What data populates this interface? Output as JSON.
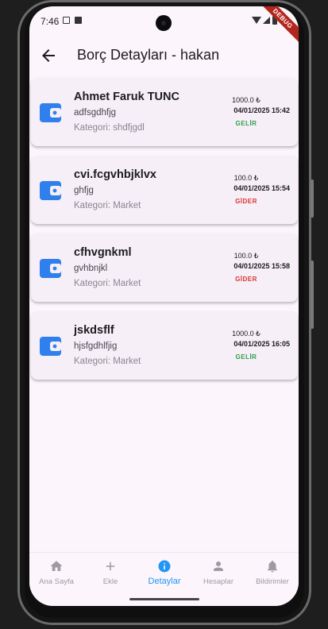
{
  "status_bar": {
    "time": "7:46",
    "debug_label": "DEBUG"
  },
  "app_bar": {
    "title": "Borç Detayları - hakan"
  },
  "colors": {
    "income": "#2e9e48",
    "expense": "#d9362c",
    "accent": "#2196f3",
    "wallet": "#2f80ed"
  },
  "debts": [
    {
      "name": "Ahmet Faruk TUNC",
      "description": "adfsgdhfjg",
      "category": "Kategori: shdfjgdl",
      "amount": "1000.0 ₺",
      "date": "04/01/2025 15:42",
      "type": "GELİR",
      "kind": "income"
    },
    {
      "name": "cvi.fcgvhbjklvx",
      "description": "ghfjg",
      "category": "Kategori: Market",
      "amount": "100.0 ₺",
      "date": "04/01/2025 15:54",
      "type": "GİDER",
      "kind": "expense"
    },
    {
      "name": "cfhvgnkml",
      "description": "gvhbnjkl",
      "category": "Kategori: Market",
      "amount": "100.0 ₺",
      "date": "04/01/2025 15:58",
      "type": "GİDER",
      "kind": "expense"
    },
    {
      "name": "jskdsflf",
      "description": "hjsfgdhlfjig",
      "category": "Kategori: Market",
      "amount": "1000.0 ₺",
      "date": "04/01/2025 16:05",
      "type": "GELİR",
      "kind": "income"
    }
  ],
  "bottom_nav": {
    "items": [
      {
        "label": "Ana Sayfa",
        "icon": "home-icon",
        "active": false
      },
      {
        "label": "Ekle",
        "icon": "add-icon",
        "active": false
      },
      {
        "label": "Detaylar",
        "icon": "info-icon",
        "active": true
      },
      {
        "label": "Hesaplar",
        "icon": "person-icon",
        "active": false
      },
      {
        "label": "Bildirimler",
        "icon": "bell-icon",
        "active": false
      }
    ]
  }
}
